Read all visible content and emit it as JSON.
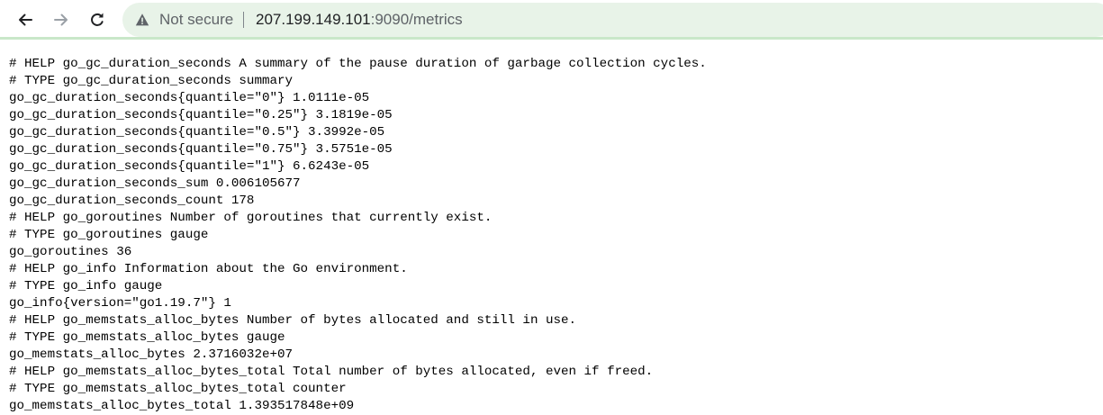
{
  "browser": {
    "back_icon": "arrow-left-icon",
    "forward_icon": "arrow-right-icon",
    "reload_icon": "reload-icon",
    "security_icon": "warning-triangle-icon",
    "security_label": "Not secure",
    "url_host": "207.199.149.101",
    "url_rest": ":9090/metrics",
    "accent_color": "#c9e7c9",
    "omnibox_color": "#e8f3e8"
  },
  "metrics": {
    "lines": [
      "# HELP go_gc_duration_seconds A summary of the pause duration of garbage collection cycles.",
      "# TYPE go_gc_duration_seconds summary",
      "go_gc_duration_seconds{quantile=\"0\"} 1.0111e-05",
      "go_gc_duration_seconds{quantile=\"0.25\"} 3.1819e-05",
      "go_gc_duration_seconds{quantile=\"0.5\"} 3.3992e-05",
      "go_gc_duration_seconds{quantile=\"0.75\"} 3.5751e-05",
      "go_gc_duration_seconds{quantile=\"1\"} 6.6243e-05",
      "go_gc_duration_seconds_sum 0.006105677",
      "go_gc_duration_seconds_count 178",
      "# HELP go_goroutines Number of goroutines that currently exist.",
      "# TYPE go_goroutines gauge",
      "go_goroutines 36",
      "# HELP go_info Information about the Go environment.",
      "# TYPE go_info gauge",
      "go_info{version=\"go1.19.7\"} 1",
      "# HELP go_memstats_alloc_bytes Number of bytes allocated and still in use.",
      "# TYPE go_memstats_alloc_bytes gauge",
      "go_memstats_alloc_bytes 2.3716032e+07",
      "# HELP go_memstats_alloc_bytes_total Total number of bytes allocated, even if freed.",
      "# TYPE go_memstats_alloc_bytes_total counter",
      "go_memstats_alloc_bytes_total 1.393517848e+09"
    ]
  }
}
